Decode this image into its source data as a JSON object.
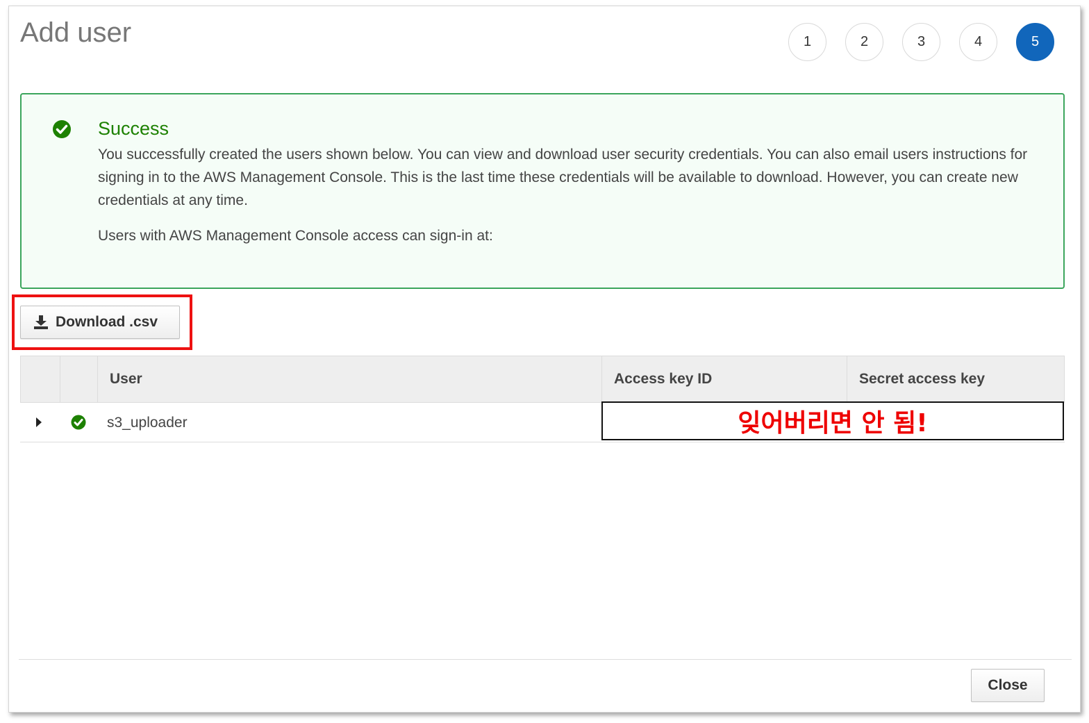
{
  "dialog": {
    "title": "Add user",
    "steps": [
      "1",
      "2",
      "3",
      "4",
      "5"
    ],
    "active_step": "5"
  },
  "alert": {
    "title": "Success",
    "body": "You successfully created the users shown below. You can view and download user security credentials. You can also email users instructions for signing in to the AWS Management Console. This is the last time these credentials will be available to download. However, you can create new credentials at any time.",
    "console_text": "Users with AWS Management Console access can sign-in at:",
    "icon": "check-circle-icon"
  },
  "toolbar": {
    "download_label": "Download .csv",
    "download_icon": "download-icon"
  },
  "table": {
    "columns": [
      "User",
      "Access key ID",
      "Secret access key"
    ],
    "rows": [
      {
        "user": "s3_uploader",
        "status_icon": "check-circle-icon"
      }
    ]
  },
  "annotation": {
    "text": "잊어버리면 안 됨!",
    "color": "#ee0000"
  },
  "footer": {
    "close_label": "Close"
  },
  "colors": {
    "success": "#1d8102",
    "active_step": "#1166bb",
    "highlight": "#ee1111"
  }
}
